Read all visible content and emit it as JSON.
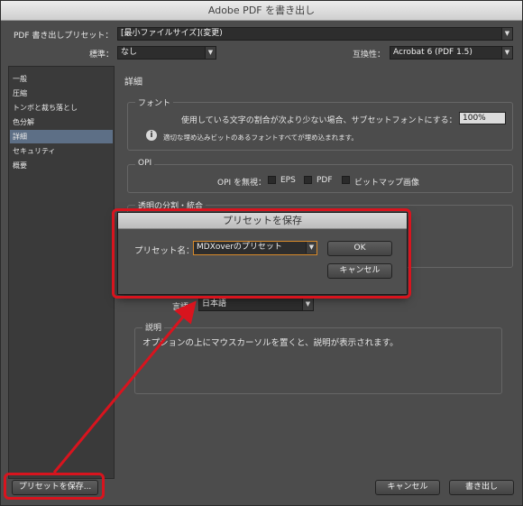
{
  "window": {
    "title": "Adobe PDF を書き出し"
  },
  "header": {
    "preset_label": "PDF 書き出しプリセット：",
    "preset_value": "[最小ファイルサイズ](変更)",
    "standard_label": "標準：",
    "standard_value": "なし",
    "compat_label": "互換性：",
    "compat_value": "Acrobat 6 (PDF 1.5)"
  },
  "sidebar": {
    "items": [
      {
        "label": "一般"
      },
      {
        "label": "圧縮"
      },
      {
        "label": "トンボと裁ち落とし"
      },
      {
        "label": "色分解"
      },
      {
        "label": "詳細"
      },
      {
        "label": "セキュリティ"
      },
      {
        "label": "概要"
      }
    ],
    "selected_index": 4
  },
  "main": {
    "section_title": "詳細",
    "font_group": {
      "title": "フォント",
      "subset_label": "使用している文字の割合が次より少ない場合、サブセットフォントにする：",
      "subset_value": "100%",
      "note": "適切な埋め込みビットのあるフォントすべてが埋め込まれます。"
    },
    "opi_group": {
      "title": "OPI",
      "omit_label": "OPI を無視：",
      "eps": "EPS",
      "pdf": "PDF",
      "bitmap": "ビットマップ画像"
    },
    "flatten_group": {
      "title": "透明の分割・統合"
    },
    "language_dropdown": {
      "label": "言語：",
      "value": "日本語"
    },
    "description_group": {
      "title": "説明",
      "text": "オプションの上にマウスカーソルを置くと、説明が表示されます。"
    }
  },
  "footer": {
    "save_preset": "プリセットを保存...",
    "cancel": "キャンセル",
    "export": "書き出し"
  },
  "dialog": {
    "title": "プリセットを保存",
    "name_label": "プリセット名：",
    "name_value": "MDXoverのプリセット",
    "ok": "OK",
    "cancel": "キャンセル"
  },
  "colors": {
    "annotation": "#d8141e",
    "panel_bg": "#4c4c4c",
    "selection": "#5d6f86"
  }
}
